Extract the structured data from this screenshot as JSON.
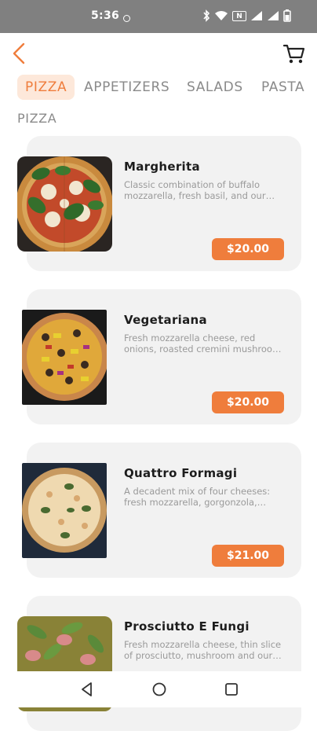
{
  "status_bar": {
    "time": "5:36",
    "nfc_label": "N"
  },
  "header": {
    "back_icon": "chevron-left-icon",
    "cart_icon": "cart-icon"
  },
  "tabs": [
    {
      "label": "PIZZA",
      "active": true
    },
    {
      "label": "APPETIZERS",
      "active": false
    },
    {
      "label": "SALADS",
      "active": false
    },
    {
      "label": "PASTA",
      "active": false
    }
  ],
  "section_title": "PIZZA",
  "items": [
    {
      "name": "Margherita",
      "description": "Classic combination of buffalo mozzarella, fresh basil, and our house-made tomato sauce",
      "price": "$20.00"
    },
    {
      "name": "Vegetariana",
      "description": "Fresh mozzarella cheese, red onions, roasted cremini mushrooms, peppers and olives",
      "price": "$20.00"
    },
    {
      "name": "Quattro Formagi",
      "description": "A decadent mix of four cheeses: fresh mozzarella, gorgonzola, Parmesan and fontina",
      "price": "$21.00"
    },
    {
      "name": "Prosciutto E Fungi",
      "description": "Fresh mozzarella cheese, thin slice of prosciutto, mushroom and our house-made sauce",
      "price": ""
    }
  ],
  "colors": {
    "accent": "#ef7d3c",
    "accent_light": "#fde8da",
    "card_bg": "#f2f2f2",
    "status_bar": "#808080"
  }
}
